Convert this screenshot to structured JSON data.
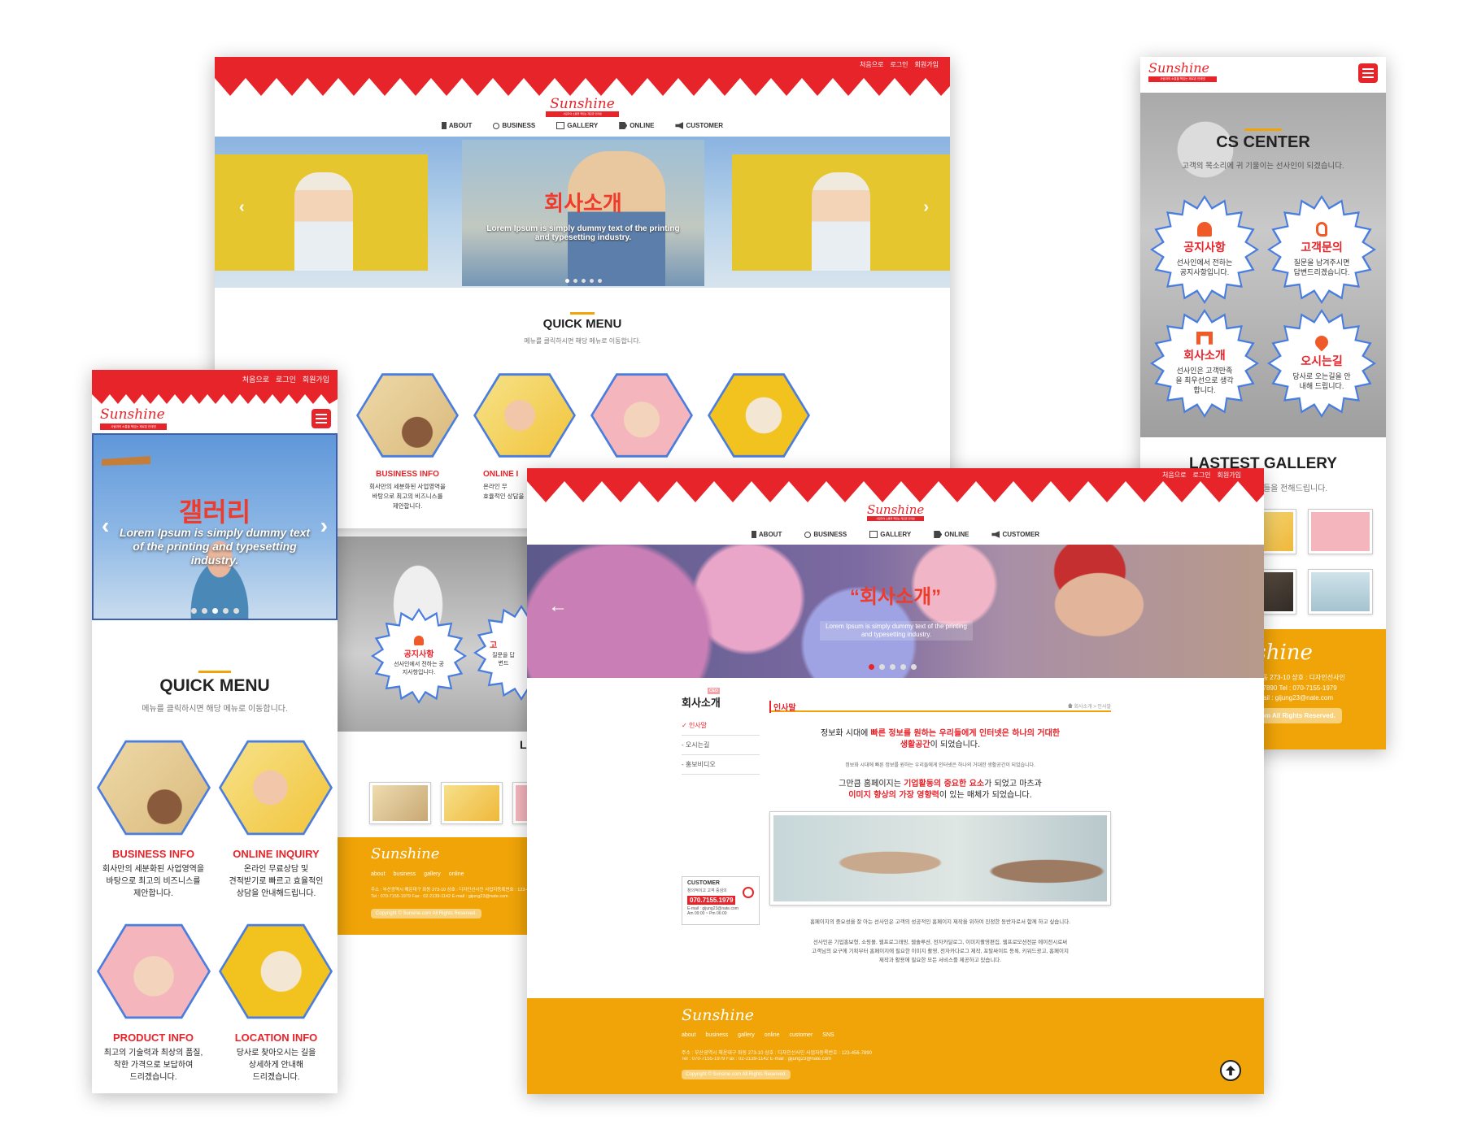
{
  "brand": {
    "logo": "Sunshine",
    "tagline": "사람과의 소통을 책임는 제로존 인테넷",
    "red": "#e8242b",
    "orange": "#f0a408",
    "blue": "#4a7de0"
  },
  "toplinks": [
    "처음으로",
    "로그인",
    "회원가입"
  ],
  "nav": [
    {
      "label": "ABOUT",
      "icon": "building-icon"
    },
    {
      "label": "BUSINESS",
      "icon": "globe-icon"
    },
    {
      "label": "GALLERY",
      "icon": "image-icon"
    },
    {
      "label": "ONLINE",
      "icon": "pencil-icon"
    },
    {
      "label": "CUSTOMER",
      "icon": "megaphone-icon"
    }
  ],
  "hero": {
    "main_title": "회사소개",
    "main_text": "Lorem Ipsum is simply dummy text of the printing and typesetting industry.",
    "mobile_title": "갤러리",
    "mobile_text": "Lorem Ipsum is simply dummy text of the printing and typesetting industry.",
    "sub_title": "“회사소개”",
    "sub_text": "Lorem Ipsum is simply dummy text of the printing and typesetting industry."
  },
  "quick": {
    "title": "QUICK MENU",
    "subtitle": "메뉴를 클릭하시면 해당 메뉴로 이동합니다.",
    "items": [
      {
        "title": "BUSINESS INFO",
        "desc1": "회사만의 세분화된 사업영역을",
        "desc2": "바탕으로 최고의 비즈니스를",
        "desc3": "제안합니다."
      },
      {
        "title": "ONLINE INQUIRY",
        "desc1": "온라인 무료상담 및",
        "desc2": "견적받기로 빠르고 효율적인",
        "desc3": "상담을 안내해드립니다."
      },
      {
        "title": "PRODUCT INFO",
        "desc1": "최고의 기술력과 최상의 품질,",
        "desc2": "착한 가격으로 보답하여",
        "desc3": "드리겠습니다."
      },
      {
        "title": "LOCATION INFO",
        "desc1": "당사로 찾아오시는 길을",
        "desc2": "상세하게 안내해",
        "desc3": "드리겠습니다."
      }
    ],
    "desktop_partial": [
      {
        "title": "BUSINESS INFO",
        "desc1": "회사만의 세분화된 사업영역을",
        "desc2": "바탕으로 최고의 비즈니스를",
        "desc3": "제안합니다."
      },
      {
        "title": "ONLINE I",
        "desc1": "온라인 무",
        "desc2": "효율적인 상담을",
        "desc3": ""
      }
    ]
  },
  "cs": {
    "title": "CS CENTER",
    "subtitle": "고객의 목소리에 귀 기울이는 선사인이 되겠습니다.",
    "items": [
      {
        "title": "공지사항",
        "desc": "선사인에서 전하는 공지사항입니다.",
        "icon": "bell-icon"
      },
      {
        "title": "고객문의",
        "desc": "질문을 남겨주시면 답변드리겠습니다.",
        "icon": "ear-icon"
      },
      {
        "title": "회사소개",
        "desc": "선사인은 고객만족을 최우선으로 생각합니다.",
        "icon": "gate-icon"
      },
      {
        "title": "오시는길",
        "desc": "당사로 오는길을 안내해 드립니다.",
        "icon": "pin-icon"
      }
    ],
    "partial": [
      {
        "title": "공지사항",
        "desc": "선사인에서 전하는 공지사항입니다."
      },
      {
        "title": "고",
        "desc": "질문을 답변드"
      }
    ]
  },
  "gallery": {
    "title": "LASTEST GALLERY",
    "subtitle": "선사인의 최신 소식들을 전해드립니다.",
    "partial_letter": "L"
  },
  "footer": {
    "links": [
      "about",
      "business",
      "gallery",
      "online",
      "customer",
      "SNS"
    ],
    "links_short": [
      "about",
      "business",
      "gallery",
      "online"
    ],
    "line1": "주소 : 부산광역시 해운대구 좌동 273-10   상호 : 디자인선사인   사업자등록번호 : 123-456-7890",
    "line2": "Tel : 070-7155-1979   Fax : 02-2139-1142   E-mail : gijung23@nate.com",
    "r_line1": "주소 : 부산광역시 해운대구 좌동 273-10  상호 : 디자인선사인",
    "r_line2": "사업자등록번호 : 123-456-7890   Tel : 070-7155-1979",
    "r_line3": "Fax : 02-2139-1142   E-mail : gijung23@nate.com",
    "copyright": "Copyright © Sunsine.com All Rights Reserved."
  },
  "sub": {
    "side_title": "회사소개",
    "side_items": [
      "인사말",
      "오시는길",
      "홍보비디오"
    ],
    "page_title": "인사말",
    "breadcrumb": "회사소개 > 인사말",
    "lead1a": "정보화 시대에 ",
    "lead1b": "빠른 정보를 원하는 우리들에게 인터넷은 하나의 거대한",
    "lead1c": "생활공간",
    "lead1d": "이 되었습니다.",
    "small1": "정보화 시대에 빠른 정보를 원하는 우리들에게 인터넷은 하나의 거대한 생활공간이 되었습니다.",
    "lead2a": "그만큼 홈페이지는 ",
    "lead2b": "기업활동의 중요한 요소",
    "lead2c": "가 되었고 마츠과",
    "lead2d": "이미지 향상의 가장 영향력",
    "lead2e": "이 있는 매체가 되었습니다.",
    "para1": "홈페이지의 중요성을 잘 아는 선사인은 고객의 성공적인 홈페이지 제작을 위하여 진정한 동반자로서 함께 하고 싶습니다.",
    "para2a": "선사인은 기업홍보형, 쇼핑몰, 웹프로그래밍, 웹솔루션, 전자카달로그, 이미지촬영편집, 웹프로모션전문 에이전시로써",
    "para2b": "고객님의 요구에 기획부터 홈페이지에 필요한 이미지 촬영, 전자카다로그 제작, 포탈싸이트 등록, 키워드광고, 홈페이지",
    "para2c": "제작과 활용에 필요한 모든 서비스를 제공하고 있습니다.",
    "cust_label": "CUSTOMER",
    "cust_desc": "창의적이고 고객 중심의",
    "cust_phone": "070.7155.1979",
    "cust_email": "E-mail : gijung23@nate.com",
    "cust_hours": "Am 09:00 ~ Pm 06:00",
    "badge": "CEO"
  }
}
